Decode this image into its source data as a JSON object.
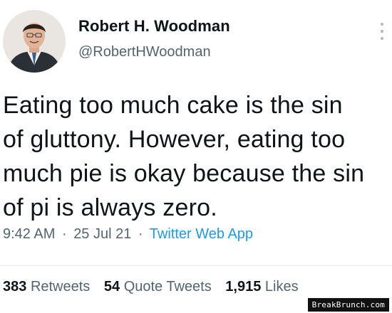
{
  "author": {
    "display_name": "Robert H. Woodman",
    "username": "@RobertHWoodman"
  },
  "icons": {
    "avatar": "user-avatar-photo",
    "more": "more-vertical-icon"
  },
  "tweet": {
    "lines": [
      "Eating too much cake is the sin",
      "of gluttony. However, eating too",
      "much pie is okay because the sin",
      "of pi is always zero."
    ]
  },
  "meta": {
    "time": "9:42 AM",
    "separator": "·",
    "date": "25 Jul 21",
    "source": "Twitter Web App"
  },
  "stats": {
    "retweets": {
      "count": "383",
      "label": "Retweets"
    },
    "quote_tweets": {
      "count": "54",
      "label": "Quote Tweets"
    },
    "likes": {
      "count": "1,915",
      "label": "Likes"
    }
  },
  "watermark": {
    "text": "BreakBrunch.com"
  },
  "colors": {
    "link": "#1d9bf0",
    "secondary_text": "#536471",
    "primary_text": "#0f1419"
  }
}
